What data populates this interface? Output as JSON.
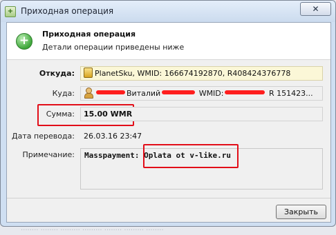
{
  "window": {
    "title": "Приходная операция",
    "close_label": "✕"
  },
  "header": {
    "title": "Приходная операция",
    "subtitle": "Детали операции приведены ниже"
  },
  "fields": {
    "from_label": "Откуда:",
    "from_value": "PlanetSku, WMID: 166674192870, R408424376778",
    "to_label": "Куда:",
    "to_name": "Виталий",
    "to_wmid_prefix": "WMID:",
    "to_purse_partial": "R 151423...",
    "amount_label": "Сумма:",
    "amount_value": "15.00 WMR",
    "date_label": "Дата перевода:",
    "date_value": "26.03.16 23:47",
    "note_label": "Примечание:",
    "note_part1": "Masspayment:",
    "note_part2": "Oplata ot v-like.ru"
  },
  "buttons": {
    "close": "Закрыть"
  },
  "colors": {
    "highlight_red": "#e20d18",
    "field_highlight": "#fbf7d7"
  }
}
